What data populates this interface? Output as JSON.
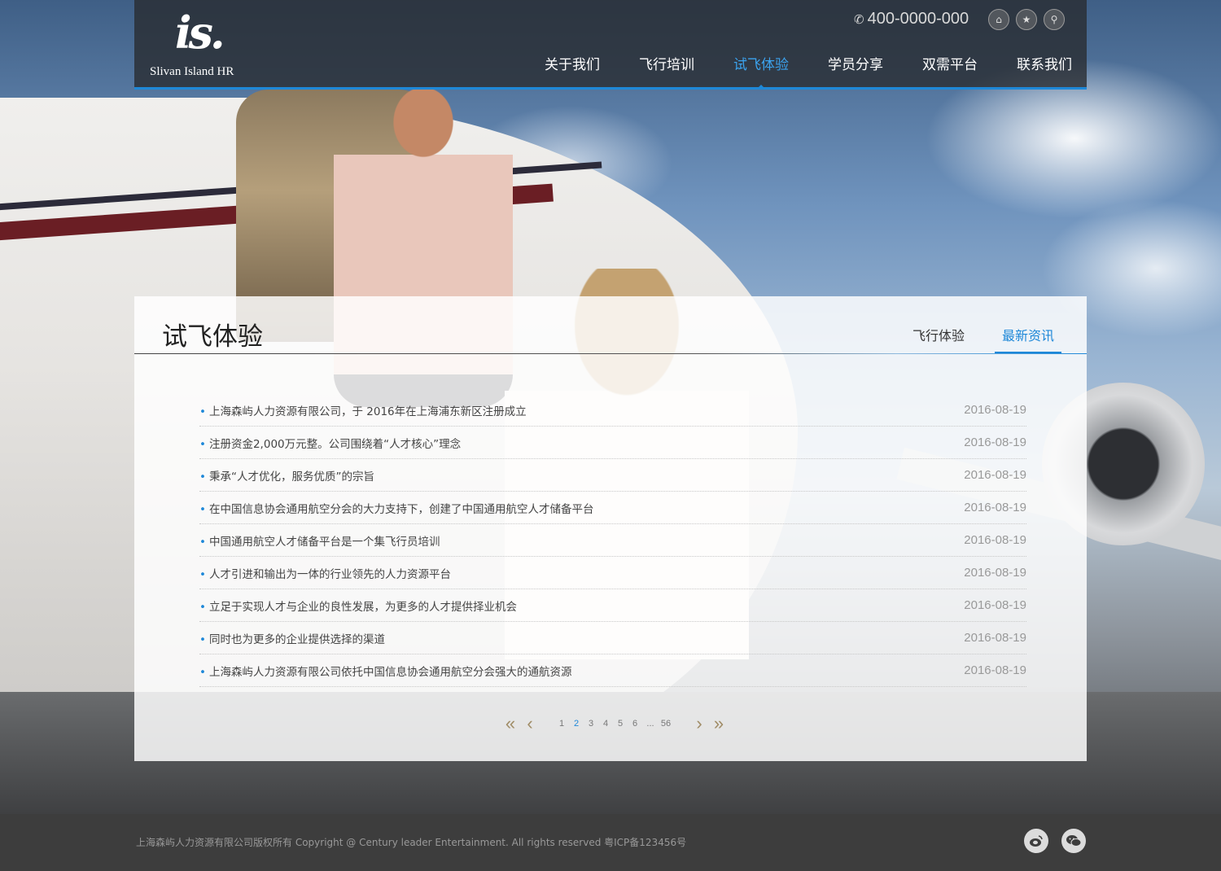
{
  "header": {
    "logo_text": "Slivan Island HR",
    "logo_mark": "is.",
    "phone": "400-0000-000",
    "icons": [
      "home-icon",
      "star-icon",
      "location-icon"
    ],
    "nav": [
      {
        "label": "关于我们"
      },
      {
        "label": "飞行培训"
      },
      {
        "label": "试飞体验",
        "active": true
      },
      {
        "label": "学员分享"
      },
      {
        "label": "双需平台"
      },
      {
        "label": "联系我们"
      }
    ]
  },
  "panel": {
    "title": "试飞体验",
    "subtabs": [
      {
        "label": "飞行体验"
      },
      {
        "label": "最新资讯",
        "active": true
      }
    ],
    "news": [
      {
        "title": "上海森屿人力资源有限公司，于 2016年在上海浦东新区注册成立",
        "date": "2016-08-19"
      },
      {
        "title": "注册资金2,000万元整。公司围绕着“人才核心”理念",
        "date": "2016-08-19"
      },
      {
        "title": "秉承“人才优化，服务优质”的宗旨",
        "date": "2016-08-19"
      },
      {
        "title": "在中国信息协会通用航空分会的大力支持下，创建了中国通用航空人才储备平台",
        "date": "2016-08-19"
      },
      {
        "title": "中国通用航空人才储备平台是一个集飞行员培训",
        "date": "2016-08-19"
      },
      {
        "title": "人才引进和输出为一体的行业领先的人力资源平台",
        "date": "2016-08-19"
      },
      {
        "title": "立足于实现人才与企业的良性发展，为更多的人才提供择业机会",
        "date": "2016-08-19"
      },
      {
        "title": "同时也为更多的企业提供选择的渠道",
        "date": "2016-08-19"
      },
      {
        "title": "上海森屿人力资源有限公司依托中国信息协会通用航空分会强大的通航资源",
        "date": "2016-08-19"
      }
    ],
    "pagination": {
      "first": "«",
      "prev": "‹",
      "pages": [
        "1",
        "2",
        "3",
        "4",
        "5",
        "6"
      ],
      "current": "2",
      "ellipsis": "...",
      "last_page": "56",
      "next": "›",
      "last": "»"
    }
  },
  "footer": {
    "copyright": "上海森屿人力资源有限公司版权所有 Copyright @ Century leader Entertainment. All rights reserved   粤ICP备123456号",
    "social": [
      "weibo-icon",
      "wechat-icon"
    ]
  },
  "colors": {
    "accent": "#1e88d8",
    "header_bg": "#2c2e32",
    "footer_bg": "#3d3d3d"
  }
}
